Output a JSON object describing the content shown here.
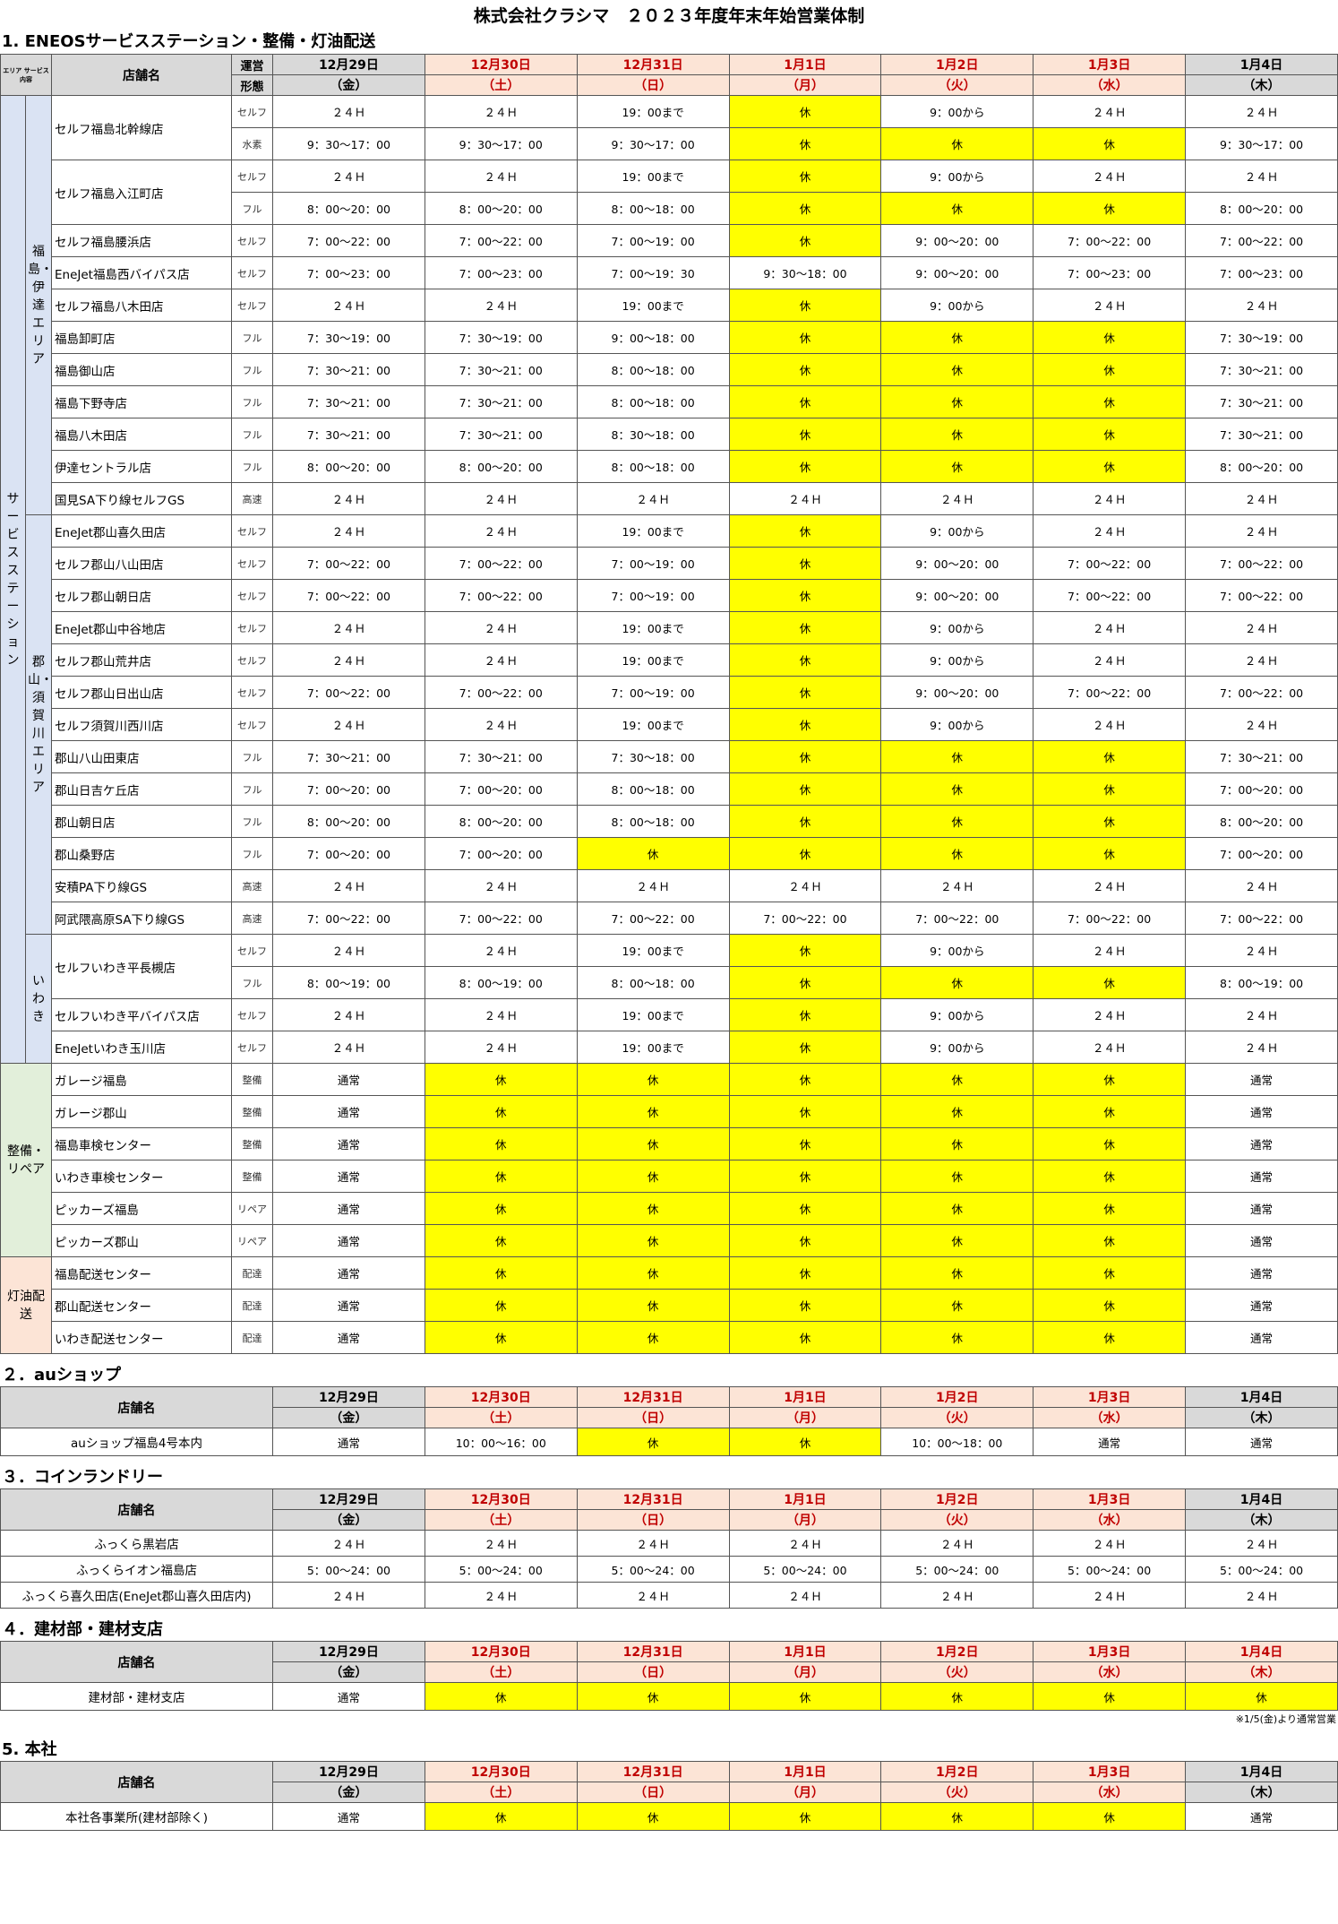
{
  "title": "株式会社クラシマ　２０２３年度年末年始営業体制",
  "days": [
    {
      "date": "12月29日",
      "dow": "（金）",
      "style": "gray"
    },
    {
      "date": "12月30日",
      "dow": "（土）",
      "style": "pink"
    },
    {
      "date": "12月31日",
      "dow": "（日）",
      "style": "pink"
    },
    {
      "date": "1月1日",
      "dow": "（月）",
      "style": "pink"
    },
    {
      "date": "1月2日",
      "dow": "（火）",
      "style": "pink"
    },
    {
      "date": "1月3日",
      "dow": "（水）",
      "style": "pink"
    },
    {
      "date": "1月4日",
      "dow": "（木）",
      "style": "gray"
    }
  ],
  "labels": {
    "area_header": "エリア サービス内容",
    "store_header": "店舗名",
    "ops_header_top": "運営",
    "ops_header_bottom": "形態"
  },
  "section1": {
    "title": "1. ENEOSサービスステーション・整備・灯油配送",
    "groups": [
      {
        "label": "サービスステーション",
        "class": "ss"
      },
      {
        "label": "整備・リペア",
        "class": "rp"
      },
      {
        "label": "灯油配送",
        "class": "ko"
      }
    ],
    "areas": [
      {
        "label": "福島・伊達エリア"
      },
      {
        "label": "郡山・須賀川エリア"
      },
      {
        "label": "いわき"
      }
    ],
    "rows": [
      {
        "g": 0,
        "a": 0,
        "store": "セルフ福島北幹線店",
        "span": 2,
        "type": "セルフ",
        "cells": [
          "２４Ｈ",
          "２４Ｈ",
          "19：00まで",
          "休",
          "9：00から",
          "２４Ｈ",
          "２４Ｈ"
        ]
      },
      {
        "g": 0,
        "a": 0,
        "type": "水素",
        "cells": [
          "9：30〜17：00",
          "9：30〜17：00",
          "9：30〜17：00",
          "休",
          "休",
          "休",
          "9：30〜17：00"
        ]
      },
      {
        "g": 0,
        "a": 0,
        "store": "セルフ福島入江町店",
        "span": 2,
        "type": "セルフ",
        "cells": [
          "２４Ｈ",
          "２４Ｈ",
          "19：00まで",
          "休",
          "9：00から",
          "２４Ｈ",
          "２４Ｈ"
        ]
      },
      {
        "g": 0,
        "a": 0,
        "type": "フル",
        "cells": [
          "8：00〜20：00",
          "8：00〜20：00",
          "8：00〜18：00",
          "休",
          "休",
          "休",
          "8：00〜20：00"
        ]
      },
      {
        "g": 0,
        "a": 0,
        "store": "セルフ福島腰浜店",
        "type": "セルフ",
        "cells": [
          "7：00〜22：00",
          "7：00〜22：00",
          "7：00〜19：00",
          "休",
          "9：00〜20：00",
          "7：00〜22：00",
          "7：00〜22：00"
        ]
      },
      {
        "g": 0,
        "a": 0,
        "store": "EneJet福島西バイパス店",
        "type": "セルフ",
        "cells": [
          "7：00〜23：00",
          "7：00〜23：00",
          "7：00〜19：30",
          "9：30〜18：00",
          "9：00〜20：00",
          "7：00〜23：00",
          "7：00〜23：00"
        ]
      },
      {
        "g": 0,
        "a": 0,
        "store": "セルフ福島八木田店",
        "type": "セルフ",
        "cells": [
          "２４Ｈ",
          "２４Ｈ",
          "19：00まで",
          "休",
          "9：00から",
          "２４Ｈ",
          "２４Ｈ"
        ]
      },
      {
        "g": 0,
        "a": 0,
        "store": "福島卸町店",
        "type": "フル",
        "cells": [
          "7：30〜19：00",
          "7：30〜19：00",
          "9：00〜18：00",
          "休",
          "休",
          "休",
          "7：30〜19：00"
        ]
      },
      {
        "g": 0,
        "a": 0,
        "store": "福島御山店",
        "type": "フル",
        "cells": [
          "7：30〜21：00",
          "7：30〜21：00",
          "8：00〜18：00",
          "休",
          "休",
          "休",
          "7：30〜21：00"
        ]
      },
      {
        "g": 0,
        "a": 0,
        "store": "福島下野寺店",
        "type": "フル",
        "cells": [
          "7：30〜21：00",
          "7：30〜21：00",
          "8：00〜18：00",
          "休",
          "休",
          "休",
          "7：30〜21：00"
        ]
      },
      {
        "g": 0,
        "a": 0,
        "store": "福島八木田店",
        "type": "フル",
        "cells": [
          "7：30〜21：00",
          "7：30〜21：00",
          "8：30〜18：00",
          "休",
          "休",
          "休",
          "7：30〜21：00"
        ]
      },
      {
        "g": 0,
        "a": 0,
        "store": "伊達セントラル店",
        "type": "フル",
        "cells": [
          "8：00〜20：00",
          "8：00〜20：00",
          "8：00〜18：00",
          "休",
          "休",
          "休",
          "8：00〜20：00"
        ]
      },
      {
        "g": 0,
        "a": 0,
        "store": "国見SA下り線セルフGS",
        "type": "高速",
        "cells": [
          "２４Ｈ",
          "２４Ｈ",
          "２４Ｈ",
          "２４Ｈ",
          "２４Ｈ",
          "２４Ｈ",
          "２４Ｈ"
        ]
      },
      {
        "g": 0,
        "a": 1,
        "store": "EneJet郡山喜久田店",
        "type": "セルフ",
        "cells": [
          "２４Ｈ",
          "２４Ｈ",
          "19：00まで",
          "休",
          "9：00から",
          "２４Ｈ",
          "２４Ｈ"
        ]
      },
      {
        "g": 0,
        "a": 1,
        "store": "セルフ郡山八山田店",
        "type": "セルフ",
        "cells": [
          "7：00〜22：00",
          "7：00〜22：00",
          "7：00〜19：00",
          "休",
          "9：00〜20：00",
          "7：00〜22：00",
          "7：00〜22：00"
        ]
      },
      {
        "g": 0,
        "a": 1,
        "store": "セルフ郡山朝日店",
        "type": "セルフ",
        "cells": [
          "7：00〜22：00",
          "7：00〜22：00",
          "7：00〜19：00",
          "休",
          "9：00〜20：00",
          "7：00〜22：00",
          "7：00〜22：00"
        ]
      },
      {
        "g": 0,
        "a": 1,
        "store": "EneJet郡山中谷地店",
        "type": "セルフ",
        "cells": [
          "２４Ｈ",
          "２４Ｈ",
          "19：00まで",
          "休",
          "9：00から",
          "２４Ｈ",
          "２４Ｈ"
        ]
      },
      {
        "g": 0,
        "a": 1,
        "store": "セルフ郡山荒井店",
        "type": "セルフ",
        "cells": [
          "２４Ｈ",
          "２４Ｈ",
          "19：00まで",
          "休",
          "9：00から",
          "２４Ｈ",
          "２４Ｈ"
        ]
      },
      {
        "g": 0,
        "a": 1,
        "store": "セルフ郡山日出山店",
        "type": "セルフ",
        "cells": [
          "7：00〜22：00",
          "7：00〜22：00",
          "7：00〜19：00",
          "休",
          "9：00〜20：00",
          "7：00〜22：00",
          "7：00〜22：00"
        ]
      },
      {
        "g": 0,
        "a": 1,
        "store": "セルフ須賀川西川店",
        "type": "セルフ",
        "cells": [
          "２４Ｈ",
          "２４Ｈ",
          "19：00まで",
          "休",
          "9：00から",
          "２４Ｈ",
          "２４Ｈ"
        ]
      },
      {
        "g": 0,
        "a": 1,
        "store": "郡山八山田東店",
        "type": "フル",
        "cells": [
          "7：30〜21：00",
          "7：30〜21：00",
          "7：30〜18：00",
          "休",
          "休",
          "休",
          "7：30〜21：00"
        ]
      },
      {
        "g": 0,
        "a": 1,
        "store": "郡山日吉ケ丘店",
        "type": "フル",
        "cells": [
          "7：00〜20：00",
          "7：00〜20：00",
          "8：00〜18：00",
          "休",
          "休",
          "休",
          "7：00〜20：00"
        ]
      },
      {
        "g": 0,
        "a": 1,
        "store": "郡山朝日店",
        "type": "フル",
        "cells": [
          "8：00〜20：00",
          "8：00〜20：00",
          "8：00〜18：00",
          "休",
          "休",
          "休",
          "8：00〜20：00"
        ]
      },
      {
        "g": 0,
        "a": 1,
        "store": "郡山桑野店",
        "type": "フル",
        "cells": [
          "7：00〜20：00",
          "7：00〜20：00",
          "休",
          "休",
          "休",
          "休",
          "7：00〜20：00"
        ]
      },
      {
        "g": 0,
        "a": 1,
        "store": "安積PA下り線GS",
        "type": "高速",
        "cells": [
          "２４Ｈ",
          "２４Ｈ",
          "２４Ｈ",
          "２４Ｈ",
          "２４Ｈ",
          "２４Ｈ",
          "２４Ｈ"
        ]
      },
      {
        "g": 0,
        "a": 1,
        "store": "阿武隈高原SA下り線GS",
        "type": "高速",
        "cells": [
          "7：00〜22：00",
          "7：00〜22：00",
          "7：00〜22：00",
          "7：00〜22：00",
          "7：00〜22：00",
          "7：00〜22：00",
          "7：00〜22：00"
        ]
      },
      {
        "g": 0,
        "a": 2,
        "store": "セルフいわき平長槻店",
        "span": 2,
        "type": "セルフ",
        "cells": [
          "２４Ｈ",
          "２４Ｈ",
          "19：00まで",
          "休",
          "9：00から",
          "２４Ｈ",
          "２４Ｈ"
        ]
      },
      {
        "g": 0,
        "a": 2,
        "type": "フル",
        "cells": [
          "8：00〜19：00",
          "8：00〜19：00",
          "8：00〜18：00",
          "休",
          "休",
          "休",
          "8：00〜19：00"
        ]
      },
      {
        "g": 0,
        "a": 2,
        "store": "セルフいわき平バイパス店",
        "type": "セルフ",
        "cells": [
          "２４Ｈ",
          "２４Ｈ",
          "19：00まで",
          "休",
          "9：00から",
          "２４Ｈ",
          "２４Ｈ"
        ]
      },
      {
        "g": 0,
        "a": 2,
        "store": "EneJetいわき玉川店",
        "type": "セルフ",
        "cells": [
          "２４Ｈ",
          "２４Ｈ",
          "19：00まで",
          "休",
          "9：00から",
          "２４Ｈ",
          "２４Ｈ"
        ]
      },
      {
        "g": 1,
        "store": "ガレージ福島",
        "type": "整備",
        "cells": [
          "通常",
          "休",
          "休",
          "休",
          "休",
          "休",
          "通常"
        ]
      },
      {
        "g": 1,
        "store": "ガレージ郡山",
        "type": "整備",
        "cells": [
          "通常",
          "休",
          "休",
          "休",
          "休",
          "休",
          "通常"
        ]
      },
      {
        "g": 1,
        "store": "福島車検センター",
        "type": "整備",
        "cells": [
          "通常",
          "休",
          "休",
          "休",
          "休",
          "休",
          "通常"
        ]
      },
      {
        "g": 1,
        "store": "いわき車検センター",
        "type": "整備",
        "cells": [
          "通常",
          "休",
          "休",
          "休",
          "休",
          "休",
          "通常"
        ]
      },
      {
        "g": 1,
        "store": "ピッカーズ福島",
        "type": "リペア",
        "cells": [
          "通常",
          "休",
          "休",
          "休",
          "休",
          "休",
          "通常"
        ]
      },
      {
        "g": 1,
        "store": "ピッカーズ郡山",
        "type": "リペア",
        "cells": [
          "通常",
          "休",
          "休",
          "休",
          "休",
          "休",
          "通常"
        ]
      },
      {
        "g": 2,
        "store": "福島配送センター",
        "type": "配達",
        "cells": [
          "通常",
          "休",
          "休",
          "休",
          "休",
          "休",
          "通常"
        ]
      },
      {
        "g": 2,
        "store": "郡山配送センター",
        "type": "配達",
        "cells": [
          "通常",
          "休",
          "休",
          "休",
          "休",
          "休",
          "通常"
        ]
      },
      {
        "g": 2,
        "store": "いわき配送センター",
        "type": "配達",
        "cells": [
          "通常",
          "休",
          "休",
          "休",
          "休",
          "休",
          "通常"
        ]
      }
    ]
  },
  "small_sections": [
    {
      "key": "s2",
      "title": "２．auショップ",
      "rows": [
        {
          "store": "auショップ福島4号本内",
          "cells": [
            "通常",
            "10：00〜16：00",
            "休",
            "休",
            "10：00〜18：00",
            "通常",
            "通常"
          ]
        }
      ]
    },
    {
      "key": "s3",
      "title": "３．コインランドリー",
      "rows": [
        {
          "store": "ふっくら黒岩店",
          "cells": [
            "２４Ｈ",
            "２４Ｈ",
            "２４Ｈ",
            "２４Ｈ",
            "２４Ｈ",
            "２４Ｈ",
            "２４Ｈ"
          ]
        },
        {
          "store": "ふっくらイオン福島店",
          "cells": [
            "5：00〜24：00",
            "5：00〜24：00",
            "5：00〜24：00",
            "5：00〜24：00",
            "5：00〜24：00",
            "5：00〜24：00",
            "5：00〜24：00"
          ]
        },
        {
          "store": "ふっくら喜久田店(EneJet郡山喜久田店内)",
          "cells": [
            "２４Ｈ",
            "２４Ｈ",
            "２４Ｈ",
            "２４Ｈ",
            "２４Ｈ",
            "２４Ｈ",
            "２４Ｈ"
          ]
        }
      ]
    },
    {
      "key": "s4",
      "title": "４．建材部・建材支店",
      "lastPink": true,
      "rows": [
        {
          "store": "建材部・建材支店",
          "cells": [
            "通常",
            "休",
            "休",
            "休",
            "休",
            "休",
            "休"
          ]
        }
      ],
      "note": "※1/5(金)より通常営業"
    },
    {
      "key": "s5",
      "title": "5. 本社",
      "rows": [
        {
          "store": "本社各事業所(建材部除く)",
          "cells": [
            "通常",
            "休",
            "休",
            "休",
            "休",
            "休",
            "通常"
          ]
        }
      ]
    }
  ]
}
